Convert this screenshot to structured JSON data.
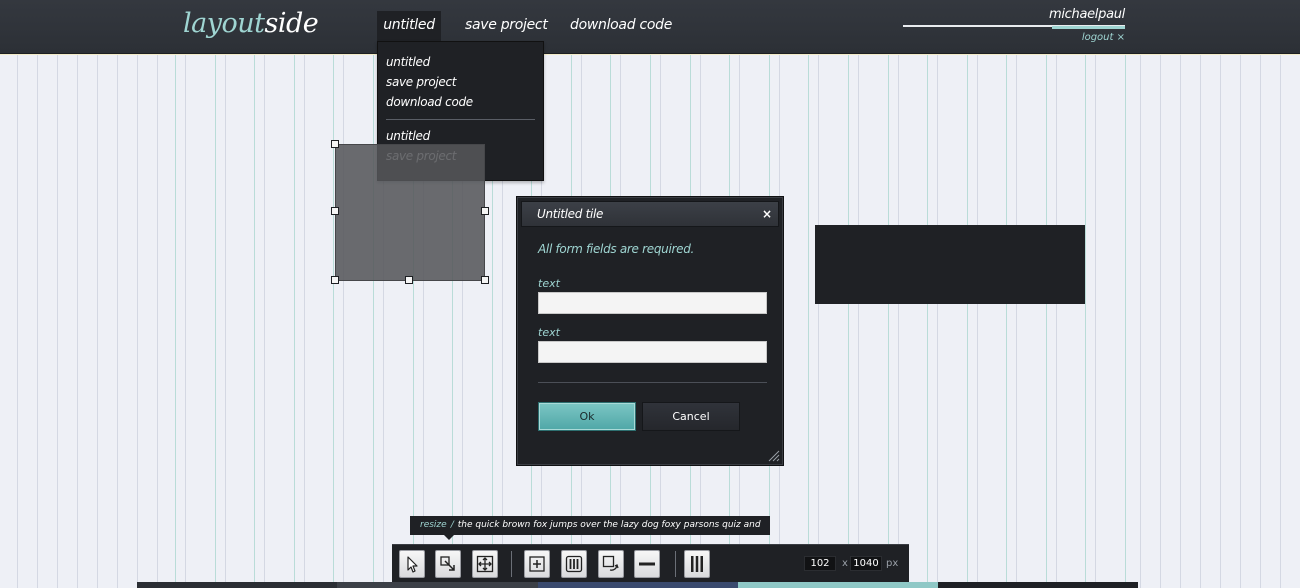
{
  "app": {
    "logo_part1": "layout",
    "logo_part2": "side"
  },
  "nav": {
    "items": [
      {
        "label": "untitled"
      },
      {
        "label": "save project"
      },
      {
        "label": "download code"
      }
    ]
  },
  "user": {
    "name": "michaelpaul",
    "logout": "logout ×"
  },
  "dropdown": {
    "group1": [
      "untitled",
      "save project",
      "download code"
    ],
    "group2": [
      "untitled",
      "save project"
    ]
  },
  "dialog": {
    "title": "Untitled tile",
    "close_icon": "×",
    "message": "All form fields are required.",
    "fields": [
      {
        "label": "text",
        "value": ""
      },
      {
        "label": "text",
        "value": ""
      }
    ],
    "ok_label": "Ok",
    "cancel_label": "Cancel"
  },
  "tooltip": {
    "label": "resize",
    "separator": "/",
    "text": "the quick brown fox jumps over the lazy dog foxy parsons quiz and"
  },
  "toolbar": {
    "tools": [
      "select-icon",
      "resize-icon",
      "move-icon",
      "add-tile-icon",
      "columns-grid-icon",
      "layer-tile-icon",
      "horizontal-rule-icon",
      "vertical-columns-icon"
    ],
    "width": "102",
    "times": "x",
    "height": "1040",
    "unit": "px"
  },
  "colors": {
    "accent": "#9fd5d2",
    "dark": "#1f2125",
    "topbar": "#30343a",
    "canvas": "#eef0f6"
  }
}
